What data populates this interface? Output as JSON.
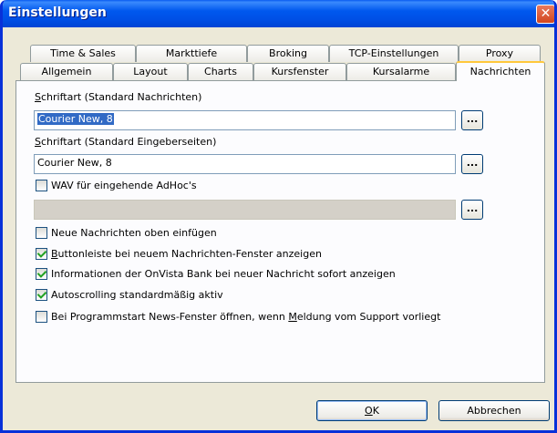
{
  "window": {
    "title": "Einstellungen"
  },
  "tabs_row1": [
    {
      "label": "Time & Sales"
    },
    {
      "label": "Markttiefe"
    },
    {
      "label": "Broking"
    },
    {
      "label": "TCP-Einstellungen"
    },
    {
      "label": "Proxy"
    }
  ],
  "tabs_row2": [
    {
      "label": "Allgemein"
    },
    {
      "label": "Layout"
    },
    {
      "label": "Charts"
    },
    {
      "label": "Kursfenster"
    },
    {
      "label": "Kursalarme"
    },
    {
      "label": "Nachrichten"
    }
  ],
  "panel": {
    "font_news": {
      "label_accel": "S",
      "label_rest": "chriftart (Standard Nachrichten)",
      "value": "Courier New, 8",
      "button": "..."
    },
    "font_input": {
      "label_accel": "S",
      "label_rest": "chriftart (Standard Eingeberseiten)",
      "value": "Courier New, 8",
      "button": "..."
    },
    "wav": {
      "label": "WAV für eingehende AdHoc's",
      "value": "",
      "button": "..."
    },
    "options": {
      "new_on_top": "Neue Nachrichten oben einfügen",
      "buttonbar_pre": "",
      "buttonbar_accel": "B",
      "buttonbar_rest": "uttonleiste bei neuem Nachrichten-Fenster anzeigen",
      "onvista": "Informationen der OnVista Bank bei neuer Nachricht sofort anzeigen",
      "autoscroll": "Autoscrolling standardmäßig aktiv",
      "newsstart_pre": "Bei Programmstart News-Fenster öffnen, wenn ",
      "newsstart_accel": "M",
      "newsstart_rest": "eldung vom Support vorliegt"
    },
    "checked": {
      "wav": false,
      "new_on_top": false,
      "buttonbar": true,
      "onvista": true,
      "autoscroll": true,
      "newsstart": false
    }
  },
  "buttons": {
    "ok_accel": "O",
    "ok_rest": "K",
    "cancel": "Abbrechen"
  },
  "colors": {
    "titlebar": "#0054E3",
    "selection": "#316AC5",
    "close": "#D2461F"
  },
  "icons": {
    "speaker": "speaker-icon",
    "close": "close-icon"
  }
}
